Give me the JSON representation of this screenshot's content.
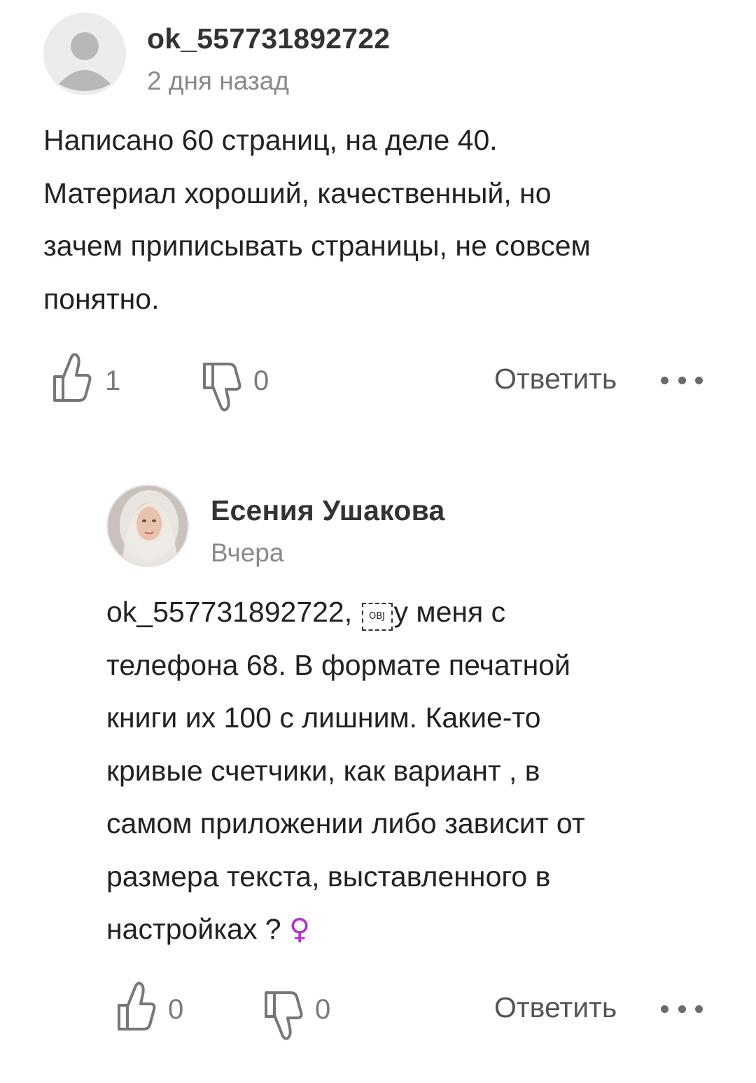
{
  "comments": [
    {
      "author": "ok_557731892722",
      "time": "2 дня назад",
      "avatar": "default-user-avatar",
      "text_lines": [
        "Написано 60 страниц, на деле 40.",
        "Материал хороший, качественный, но",
        "зачем приписывать страницы, не совсем",
        "понятно."
      ],
      "likes": "1",
      "dislikes": "0",
      "reply_label": "Ответить"
    },
    {
      "author": "Есения Ушакова",
      "time": "Вчера",
      "avatar": "user-photo-avatar",
      "text_line1_prefix": "ok_557731892722,",
      "obj_placeholder": "OBJ",
      "text_line1_suffix": "у меня с",
      "text_lines_rest": [
        "телефона 68. В формате печатной",
        "книги их 100 с лишним. Какие-то",
        "кривые счетчики, как вариант , в",
        "самом приложении либо зависит от",
        "размера текста, выставленного в"
      ],
      "text_last_line": "настройках ?",
      "emoji": "♀",
      "likes": "0",
      "dislikes": "0",
      "reply_label": "Ответить"
    }
  ],
  "colors": {
    "author": "#333333",
    "text": "#222222",
    "meta": "#8a8a8a",
    "emoji_female": "#b22fc9"
  }
}
